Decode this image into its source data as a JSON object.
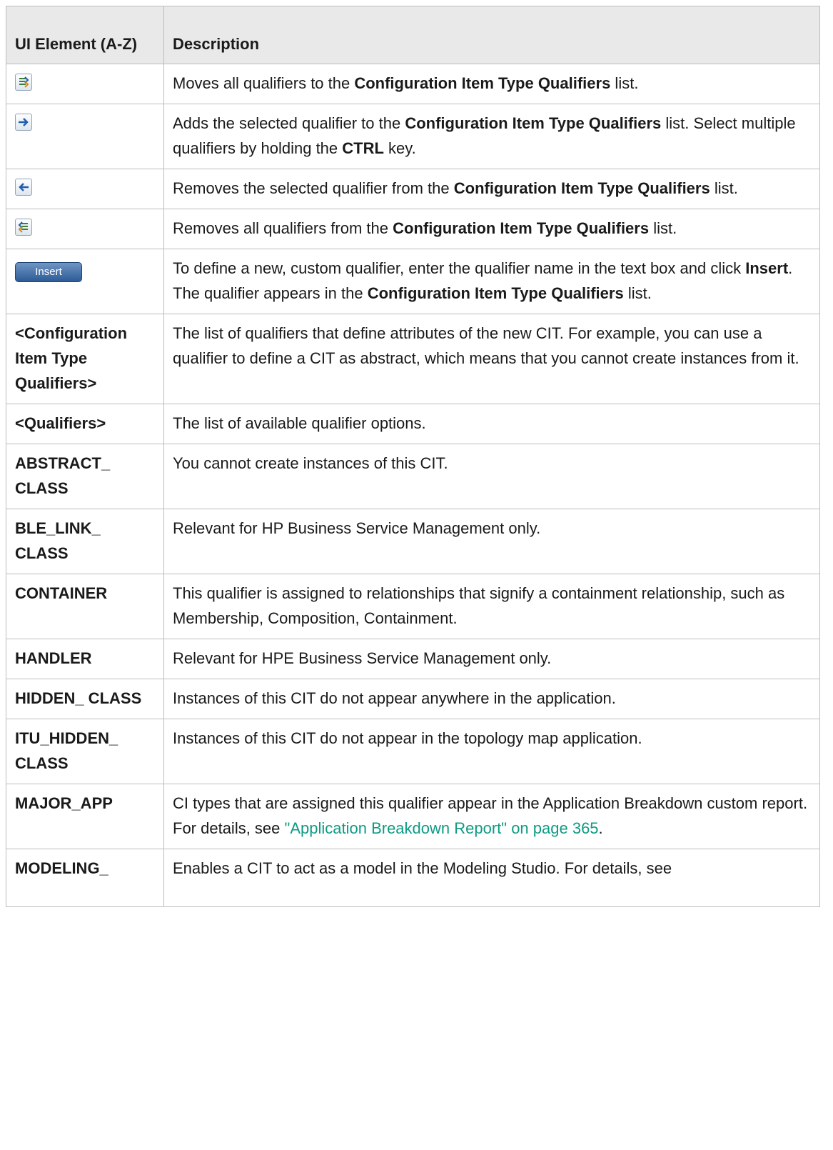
{
  "table": {
    "header": {
      "element": "UI Element (A-Z)",
      "description": "Description"
    },
    "rows": [
      {
        "icon": "move-all-right-icon",
        "parts": [
          "Moves all qualifiers to the ",
          "Configuration Item Type Qualifiers",
          " list."
        ]
      },
      {
        "icon": "move-right-icon",
        "parts": [
          "Adds the selected qualifier to the ",
          "Configuration Item Type Qualifiers",
          " list. Select multiple qualifiers by holding the ",
          "CTRL",
          " key."
        ]
      },
      {
        "icon": "move-left-icon",
        "parts": [
          "Removes the selected qualifier from the ",
          "Configuration Item Type Qualifiers",
          " list."
        ]
      },
      {
        "icon": "move-all-left-icon",
        "parts": [
          "Removes all qualifiers from the ",
          "Configuration Item Type Qualifiers",
          " list."
        ]
      },
      {
        "button_label": "Insert",
        "parts": [
          "To define a new, custom qualifier, enter the qualifier name in the text box and click ",
          "Insert",
          ". The qualifier appears in the ",
          "Configuration Item Type Qualifiers",
          " list."
        ]
      },
      {
        "element": "<Configuration Item Type Qualifiers>",
        "description": "The list of qualifiers that define attributes of the new CIT. For example, you can use a qualifier to define a CIT as abstract, which means that you cannot create instances from it."
      },
      {
        "element": "<Qualifiers>",
        "description": "The list of available qualifier options."
      },
      {
        "element": "ABSTRACT_ CLASS",
        "description": "You cannot create instances of this CIT."
      },
      {
        "element": "BLE_LINK_ CLASS",
        "description": "Relevant for HP Business Service Management only."
      },
      {
        "element": "CONTAINER",
        "description": "This qualifier is assigned to relationships that signify a containment relationship, such as Membership, Composition, Containment."
      },
      {
        "element": "HANDLER",
        "description": "Relevant for HPE Business Service Management only."
      },
      {
        "element": "HIDDEN_ CLASS",
        "description": "Instances of this CIT do not appear anywhere in the application."
      },
      {
        "element": "ITU_HIDDEN_ CLASS",
        "description": "Instances of this CIT do not appear in the topology map application."
      },
      {
        "element": "MAJOR_APP",
        "description": "CI types that are assigned this qualifier appear in the Application Breakdown custom report. For details, see ",
        "link": "\"Application Breakdown Report\" on page 365",
        "after_link": "."
      },
      {
        "element": "MODELING_",
        "description": "Enables a CIT to act as a model in the Modeling Studio. For details, see"
      }
    ]
  },
  "colors": {
    "header_bg": "#e9e9e9",
    "border": "#bdbdbd",
    "link": "#0d9b84",
    "button": "#2c5b96"
  }
}
